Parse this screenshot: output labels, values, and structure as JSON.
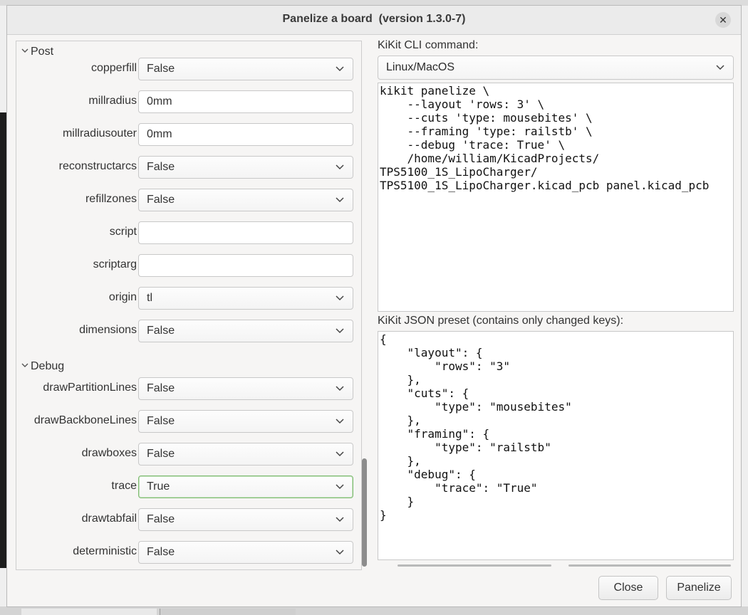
{
  "dialog": {
    "title": "Panelize a board  (version 1.3.0-7)",
    "close_glyph": "✕"
  },
  "sections": {
    "post": {
      "title": "Post",
      "rows": [
        {
          "label": "copperfill",
          "value": "False",
          "kind": "combo"
        },
        {
          "label": "millradius",
          "value": "0mm",
          "kind": "text"
        },
        {
          "label": "millradiusouter",
          "value": "0mm",
          "kind": "text"
        },
        {
          "label": "reconstructarcs",
          "value": "False",
          "kind": "combo"
        },
        {
          "label": "refillzones",
          "value": "False",
          "kind": "combo"
        },
        {
          "label": "script",
          "value": "",
          "kind": "text"
        },
        {
          "label": "scriptarg",
          "value": "",
          "kind": "text"
        },
        {
          "label": "origin",
          "value": "tl",
          "kind": "combo"
        },
        {
          "label": "dimensions",
          "value": "False",
          "kind": "combo"
        }
      ]
    },
    "debug": {
      "title": "Debug",
      "rows": [
        {
          "label": "drawPartitionLines",
          "value": "False",
          "kind": "combo"
        },
        {
          "label": "drawBackboneLines",
          "value": "False",
          "kind": "combo"
        },
        {
          "label": "drawboxes",
          "value": "False",
          "kind": "combo"
        },
        {
          "label": "trace",
          "value": "True",
          "kind": "combo"
        },
        {
          "label": "drawtabfail",
          "value": "False",
          "kind": "combo"
        },
        {
          "label": "deterministic",
          "value": "False",
          "kind": "combo"
        }
      ]
    }
  },
  "cli": {
    "label": "KiKit CLI command:",
    "os_selected": "Linux/MacOS",
    "command": "kikit panelize \\\n    --layout 'rows: 3' \\\n    --cuts 'type: mousebites' \\\n    --framing 'type: railstb' \\\n    --debug 'trace: True' \\\n    /home/william/KicadProjects/\nTPS5100_1S_LipoCharger/\nTPS5100_1S_LipoCharger.kicad_pcb panel.kicad_pcb"
  },
  "json_preset": {
    "label": "KiKit JSON preset (contains only changed keys):",
    "text": "{\n    \"layout\": {\n        \"rows\": \"3\"\n    },\n    \"cuts\": {\n        \"type\": \"mousebites\"\n    },\n    \"framing\": {\n        \"type\": \"railstb\"\n    },\n    \"debug\": {\n        \"trace\": \"True\"\n    }\n}"
  },
  "buttons": {
    "close": "Close",
    "panelize": "Panelize"
  },
  "colors": {
    "focus_border": "#7fbb72",
    "dialog_bg": "#f6f5f4"
  }
}
